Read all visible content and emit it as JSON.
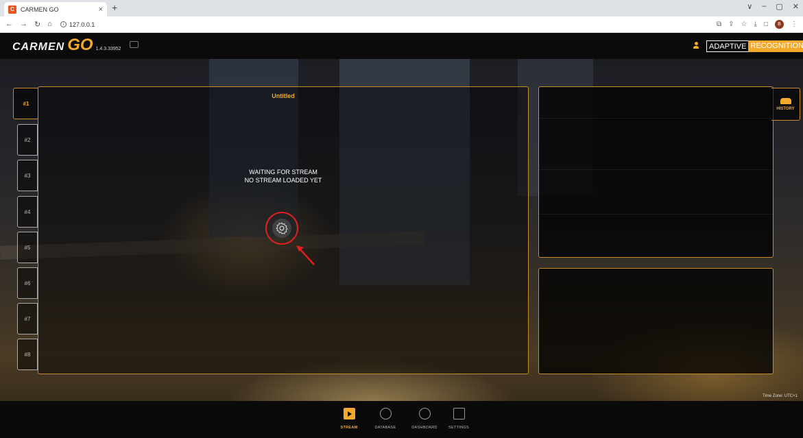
{
  "browser": {
    "tab_title": "CARMEN GO",
    "tab_close": "×",
    "new_tab": "+",
    "url": "127.0.0.1",
    "profile_initial": "B",
    "window_controls": [
      "∨",
      "–",
      "▢",
      "✕"
    ]
  },
  "app": {
    "logo_text": "CARMEN",
    "logo_go": "GO",
    "version": "1.4.3.33952",
    "brand_adaptive": "ADAPTIVE",
    "brand_recognition": "RECOGNITION",
    "accent": "#f3a92c"
  },
  "stream": {
    "title": "Untitled",
    "waiting_line1": "WAITING FOR STREAM",
    "waiting_line2": "NO STREAM LOADED YET"
  },
  "sidetabs": [
    "#1",
    "#2",
    "#3",
    "#4",
    "#5",
    "#6",
    "#7",
    "#8"
  ],
  "history_label": "HISTORY",
  "timezone": "Time Zone: UTC+1",
  "nav": [
    {
      "label": "STREAM",
      "active": true
    },
    {
      "label": "DATABASE",
      "active": false
    },
    {
      "label": "DASHBOARD",
      "active": false
    },
    {
      "label": "SETTINGS",
      "active": false
    }
  ]
}
